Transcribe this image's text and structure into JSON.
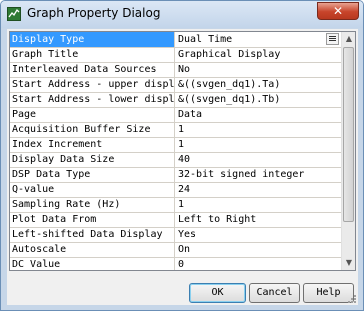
{
  "window": {
    "title": "Graph Property Dialog",
    "close_glyph": "✕"
  },
  "properties": [
    {
      "name": "Display Type",
      "value": "Dual Time",
      "selected": true
    },
    {
      "name": "Graph Title",
      "value": "Graphical Display"
    },
    {
      "name": "Interleaved Data Sources",
      "value": "No"
    },
    {
      "name": "Start Address - upper displ",
      "value": "&((svgen_dq1).Ta)"
    },
    {
      "name": "Start Address - lower displ",
      "value": "&((svgen_dq1).Tb)"
    },
    {
      "name": "Page",
      "value": "Data"
    },
    {
      "name": "Acquisition Buffer Size",
      "value": "1"
    },
    {
      "name": "Index Increment",
      "value": "1"
    },
    {
      "name": "Display Data Size",
      "value": "40"
    },
    {
      "name": "DSP Data Type",
      "value": "32-bit signed integer"
    },
    {
      "name": "Q-value",
      "value": "24"
    },
    {
      "name": "Sampling Rate (Hz)",
      "value": "1"
    },
    {
      "name": "Plot Data From",
      "value": "Left to Right"
    },
    {
      "name": "Left-shifted Data Display",
      "value": "Yes"
    },
    {
      "name": "Autoscale",
      "value": "On"
    },
    {
      "name": "DC Value",
      "value": "0"
    }
  ],
  "scrollbar": {
    "up_glyph": "▲",
    "down_glyph": "▼"
  },
  "buttons": {
    "ok": "OK",
    "cancel": "Cancel",
    "help": "Help"
  },
  "colors": {
    "selection": "#3399ff",
    "close": "#c7442b",
    "window_frame": "#c6d6e8"
  }
}
